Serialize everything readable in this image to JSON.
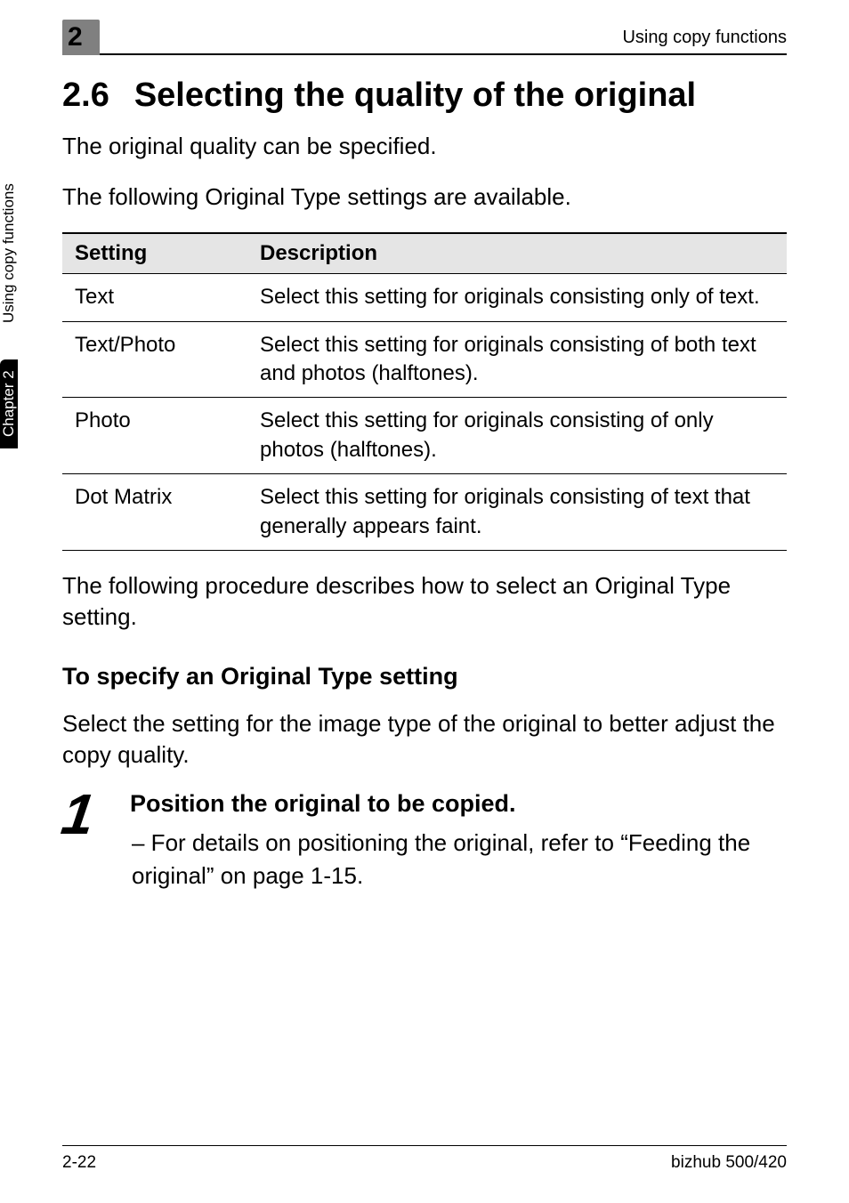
{
  "header": {
    "chapter_number": "2",
    "running_title": "Using copy functions"
  },
  "spine": {
    "chapter_label": "Chapter 2",
    "section_label": "Using copy functions"
  },
  "section": {
    "number": "2.6",
    "title": "Selecting the quality of the original",
    "intro_1": "The original quality can be specified.",
    "intro_2": "The following Original Type settings are available."
  },
  "table": {
    "headers": {
      "col1": "Setting",
      "col2": "Description"
    },
    "rows": [
      {
        "setting": "Text",
        "description": "Select this setting for originals consisting only of text."
      },
      {
        "setting": "Text/Photo",
        "description": "Select this setting for originals consisting of both text and photos (halftones)."
      },
      {
        "setting": "Photo",
        "description": "Select this setting for originals consisting of only photos (halftones)."
      },
      {
        "setting": "Dot Matrix",
        "description": "Select this setting for originals consisting of text that generally appears faint."
      }
    ]
  },
  "after_table": "The following procedure describes how to select an Original Type setting.",
  "procedure": {
    "heading": "To specify an Original Type setting",
    "lead": "Select the setting for the image type of the original to better adjust the copy quality.",
    "step_number": "1",
    "step_title": "Position the original to be copied.",
    "step_detail": "– For details on positioning the original, refer to “Feeding the original” on page 1-15."
  },
  "footer": {
    "page_number": "2-22",
    "product": "bizhub 500/420"
  }
}
